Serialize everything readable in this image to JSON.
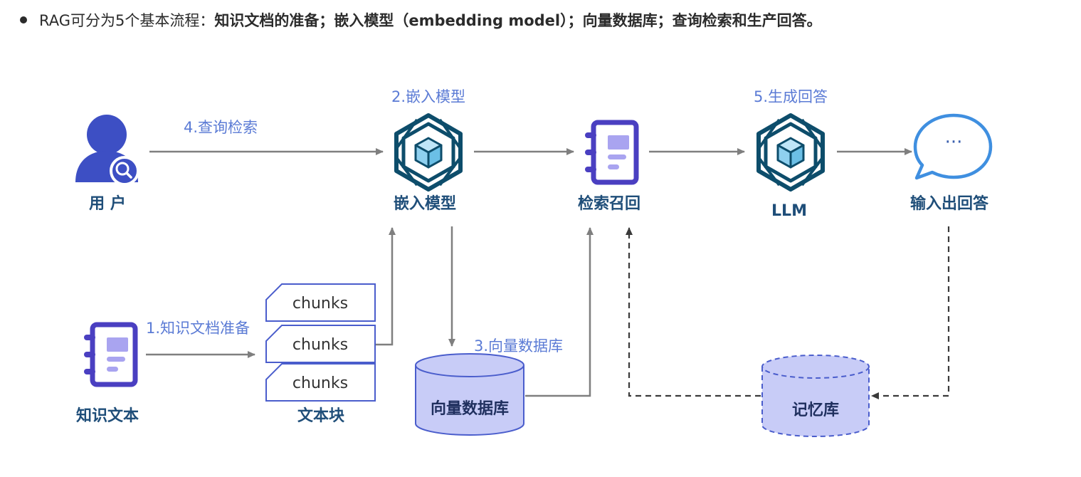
{
  "header": {
    "intro": "RAG可分为5个基本流程：",
    "part1": "知识文档的准备；",
    "part2": "嵌入模型（embedding model）；",
    "part3": "向量数据库；",
    "part4": "查询检索和生产回答。"
  },
  "nodes": {
    "user": "用 户",
    "embedding_model": "嵌入模型",
    "retrieval": "检索召回",
    "llm": "LLM",
    "output": "输入出回答",
    "knowledge_text": "知识文本",
    "text_chunks": "文本块",
    "vector_db": "向量数据库",
    "memory": "记忆库"
  },
  "chunks": [
    "chunks",
    "chunks",
    "chunks"
  ],
  "steps": {
    "step1": "1.知识文档准备",
    "step2": "2.嵌入模型",
    "step3": "3.向量数据库",
    "step4": "4.查询检索",
    "step5": "5.生成回答"
  },
  "chat_bubble_text": "···",
  "colors": {
    "node_label": "#1f4e79",
    "step_label": "#5b7bd5",
    "icon_purple": "#4a3fc1",
    "icon_light": "#a9a4f0",
    "hex_teal": "#0d4d6b",
    "cube_fill": "#8fd0ef",
    "user_blue": "#3d4fc4",
    "cylinder_fill": "#c8ccf7",
    "arrow_gray": "#7f7f7f",
    "dashed_dark": "#3a3a3a"
  }
}
